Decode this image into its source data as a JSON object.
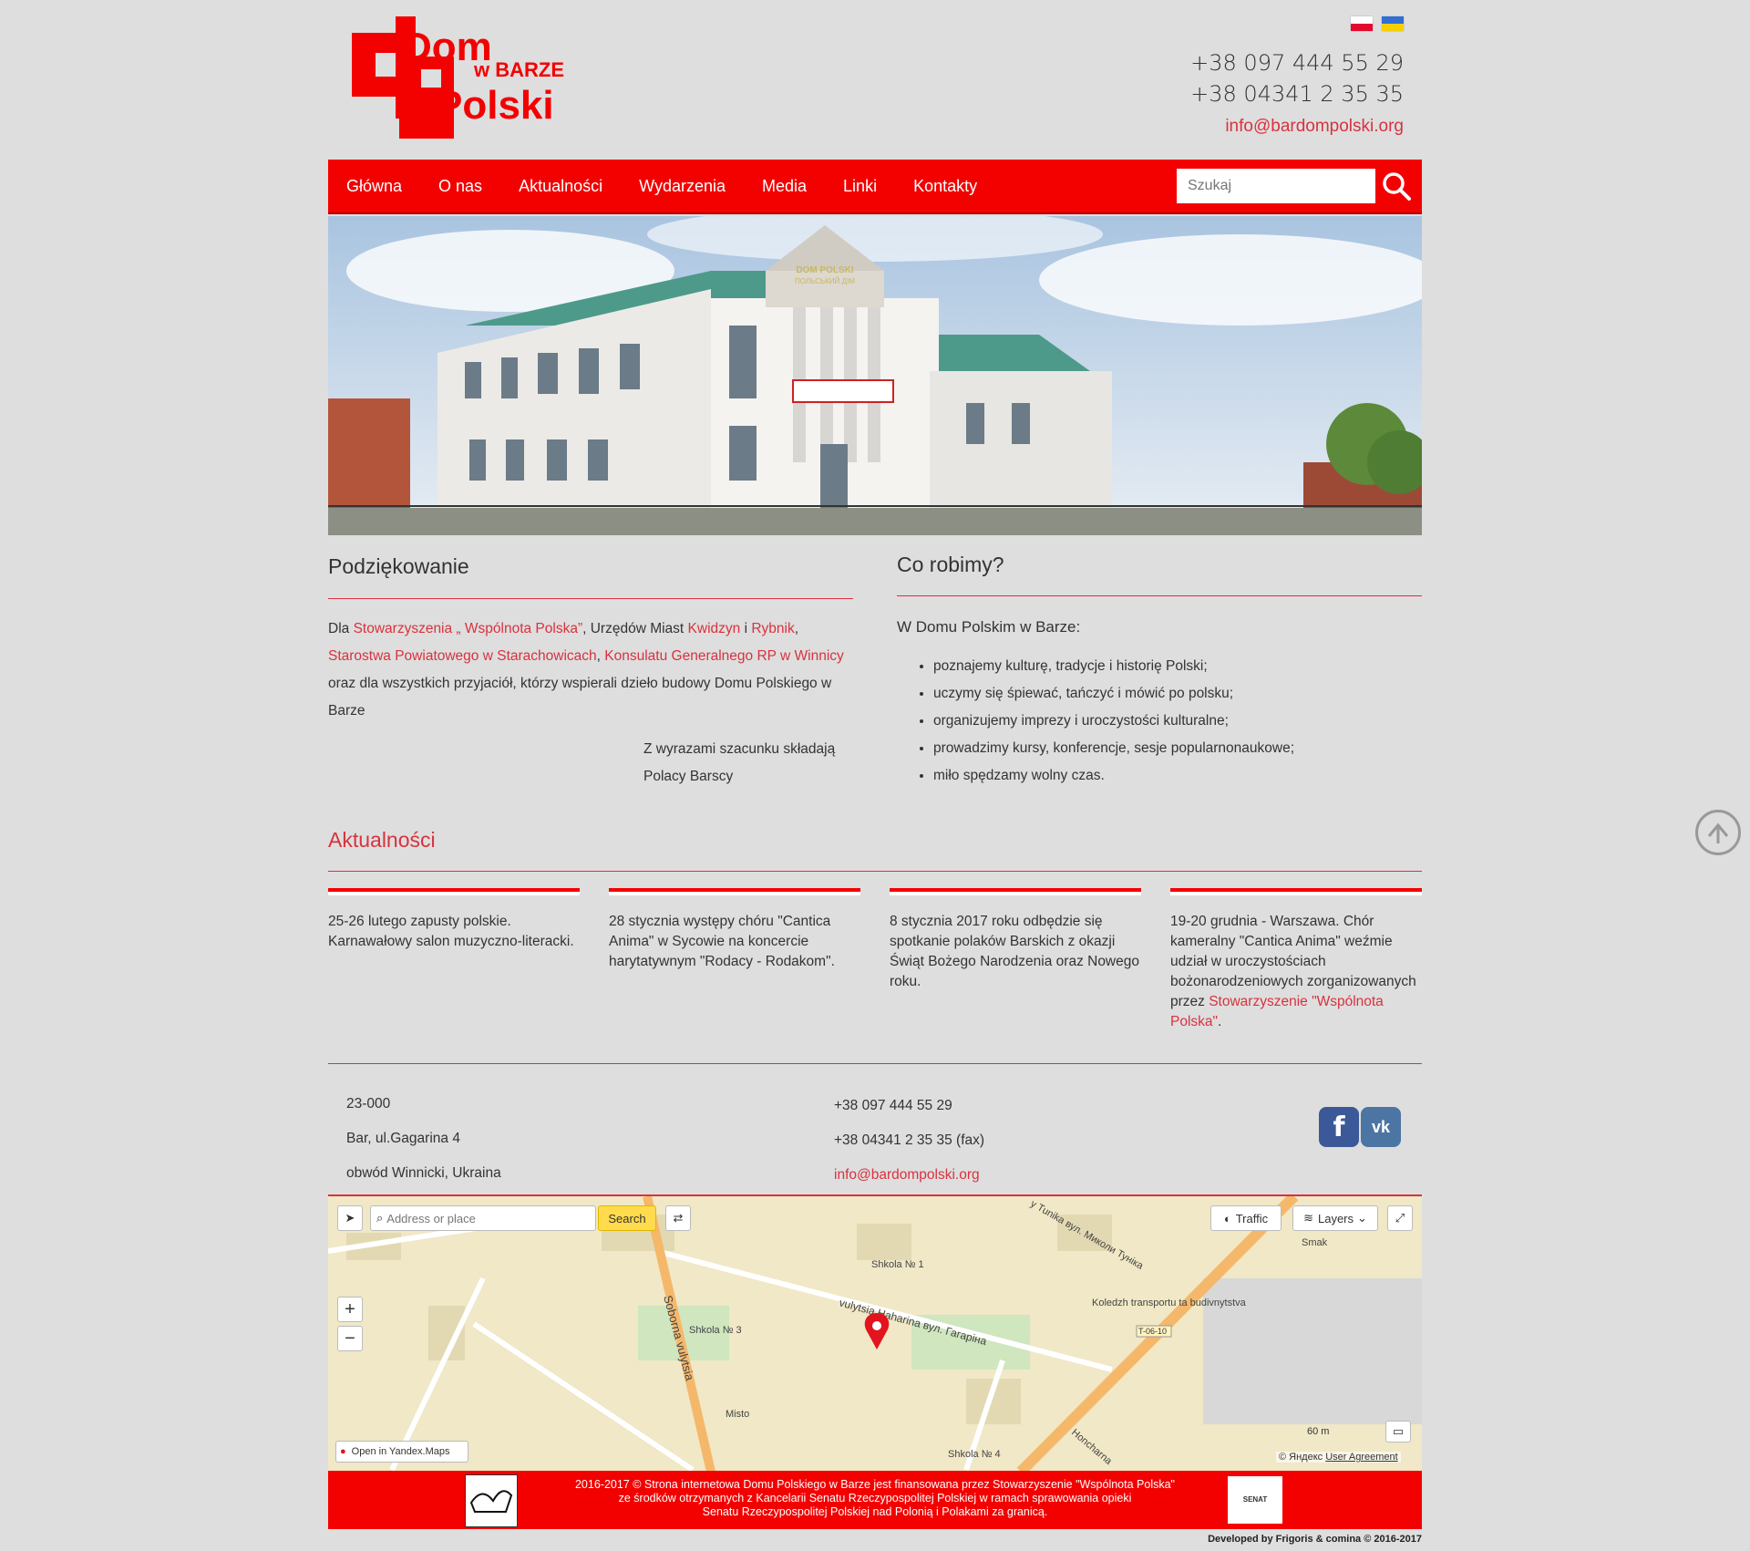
{
  "header": {
    "logo": {
      "line1": "Dom",
      "line2": "w BARZE",
      "line3": "Polski"
    },
    "languages": [
      {
        "code": "pl",
        "colors": [
          "#ffffff",
          "#e30a2e"
        ]
      },
      {
        "code": "ua",
        "colors": [
          "#2f6fd6",
          "#f5d000"
        ]
      }
    ],
    "phone1": "+38 097 444 55 29",
    "phone2": "+38 04341 2 35 35",
    "email": "info@bardompolski.org"
  },
  "nav": {
    "items": [
      "Główna",
      "O nas",
      "Aktualności",
      "Wydarzenia",
      "Media",
      "Linki",
      "Kontakty"
    ],
    "search_placeholder": "Szukaj"
  },
  "hero": {
    "sign1": "DOM POLSKI",
    "sign2": "ПОЛЬСЬКИЙ ДІМ"
  },
  "left": {
    "title": "Podziękowanie",
    "p_dla": "Dla ",
    "l1": "Stowarzyszenia „ Wspólnota Polska”",
    "t1": ", Urzędów Miast ",
    "l2": "Kwidzyn",
    "t2": " i ",
    "l3": "Rybnik",
    "t3": ", ",
    "l4": "Starostwa Powiatowego w Starachowicach",
    "t4": ", ",
    "l5": "Konsulatu Generalnego RP w Winnicy",
    "t5": " oraz dla wszystkich przyjaciół, którzy wspierali dzieło budowy Domu Polskiego w Barze",
    "sign1": "Z wyrazami szacunku składają",
    "sign2": "Polacy Barscy"
  },
  "right": {
    "title": "Co robimy?",
    "intro": "W Domu Polskim w Barze:",
    "items": [
      "poznajemy kulturę, tradycje i historię Polski;",
      "uczymy się śpiewać, tańczyć i mówić po polsku;",
      "organizujemy imprezy i uroczystości kulturalne;",
      "prowadzimy kursy, konferencje, sesje popularnonaukowe;",
      "miło spędzamy wolny czas."
    ]
  },
  "news": {
    "title": "Aktualności",
    "items": [
      {
        "text": "25-26 lutego zapusty polskie. Karnawałowy salon muzyczno-literacki."
      },
      {
        "text": "28 stycznia występy chóru \"Cantica Anima\" w Sycowie na koncercie harytatywnym \"Rodacy - Rodakom\"."
      },
      {
        "text": "8 stycznia 2017 roku odbędzie się spotkanie  polaków  Barskich z okazji Świąt Bożego Narodzenia oraz Nowego roku."
      },
      {
        "text": "19-20 grudnia - Warszawa. Chór kameralny \"Cantica Anima\" weźmie udział w uroczystościach bożonarodzeniowych zorganizowanych przez ",
        "link": "Stowarzyszenie \"Wspólnota Polska\"",
        "tail": "."
      }
    ]
  },
  "contact": {
    "postal": "23-000",
    "street": "Bar, ul.Gagarina 4",
    "region": "obwód Winnicki, Ukraina",
    "phone": "+38 097 444 55 29",
    "fax": "+38 04341 2 35 35 (fax)",
    "email": "info@bardompolski.org"
  },
  "map": {
    "search_placeholder": "Address or place",
    "search_button": "Search",
    "traffic": "Traffic",
    "layers": "Layers",
    "open_link": "Open in Yandex.Maps",
    "scale": "60 m",
    "copyright": "© Яндекс",
    "agreement": "User Agreement",
    "labels": {
      "street1": "vulytsia Haharina вул. Гагаріна",
      "street2": "Soborna vulytsia",
      "street3": "y Tunika вул. Миколи Туніка",
      "street4": "Honcharna",
      "school1": "Shkola № 1",
      "school3": "Shkola № 3",
      "school4": "Shkola № 4",
      "college": "Koledzh transportu ta budivnytstva",
      "misto": "Misto",
      "smak": "Smak",
      "road": "T-06-10"
    }
  },
  "footer": {
    "line1": "2016-2017 © Strona internetowa Domu Polskiego w Barze jest finansowana przez Stowarzyszenie \"Wspólnota Polska\"",
    "line2": "ze środków otrzymanych z Kancelarii Senatu Rzeczypospolitej Polskiej w ramach sprawowania opieki",
    "line3": "Senatu Rzeczypospolitej Polskiej nad Polonią i Polakami za granicą.",
    "senat": "SENAT",
    "developer": "Developed by Frigoris & comina © 2016-2017"
  },
  "colors": {
    "brand_red": "#f30000",
    "link_red": "#d8323e",
    "background": "#dedede"
  }
}
